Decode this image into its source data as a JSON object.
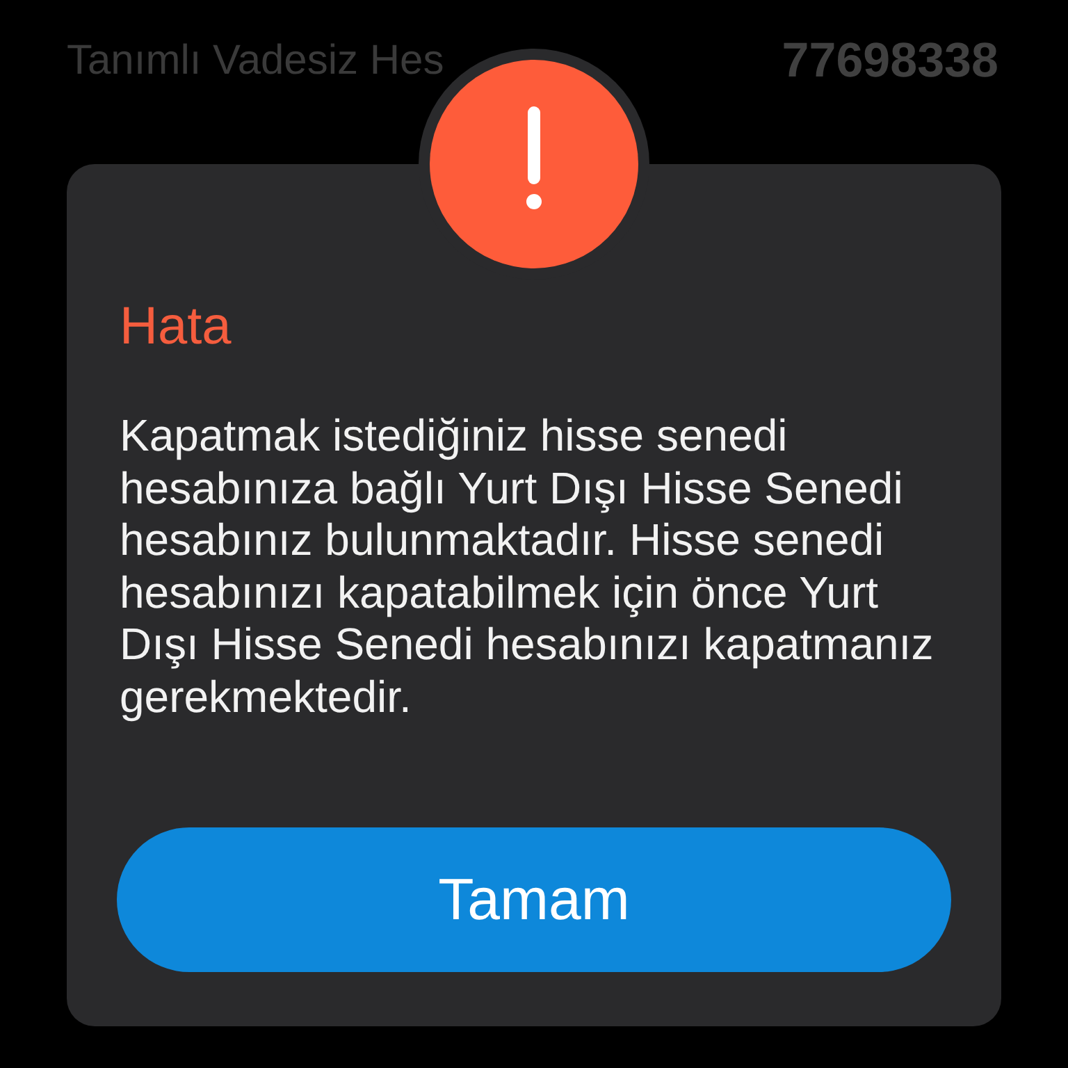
{
  "background": {
    "account_label": "Tanımlı Vadesiz Hes",
    "account_number": "77698338"
  },
  "dialog": {
    "title": "Hata",
    "message": "Kapatmak istediğiniz hisse senedi hesabınıza bağlı Yurt Dışı Hisse Senedi hesabınız bulunmaktadır. Hisse senedi hesabınızı kapatabilmek için önce Yurt Dışı Hisse Senedi hesabınızı kapatmanız gerekmektedir.",
    "button": "Tamam"
  }
}
